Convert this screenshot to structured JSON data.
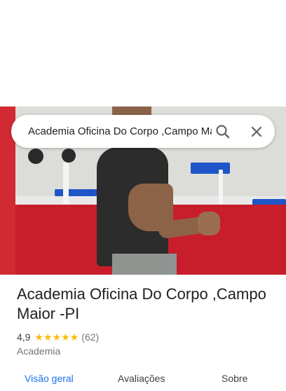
{
  "search": {
    "value": "Academia Oficina Do Corpo ,Campo Maior -PI",
    "search_icon": "search-icon",
    "close_icon": "close-icon"
  },
  "place": {
    "name": "Academia Oficina Do Corpo ,Campo Maior -PI",
    "rating": "4,9",
    "stars": 5,
    "review_count": "(62)",
    "category": "Academia"
  },
  "tabs": [
    {
      "label": "Visão geral",
      "active": true
    },
    {
      "label": "Avaliações",
      "active": false
    },
    {
      "label": "Sobre",
      "active": false
    }
  ],
  "colors": {
    "accent": "#1a73e8",
    "star": "#fbbc04",
    "text_primary": "#202124",
    "text_secondary": "#70757a"
  }
}
